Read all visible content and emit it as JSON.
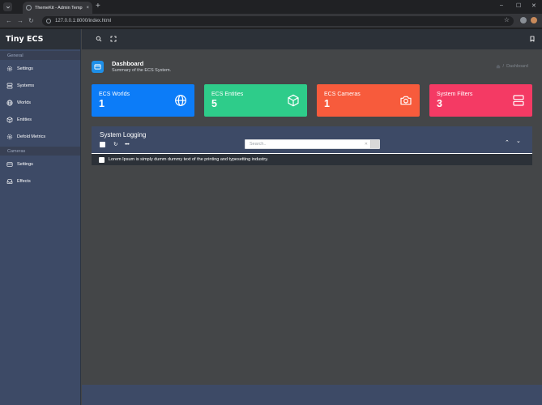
{
  "browser": {
    "tab_title": "ThemeKit - Admin Template",
    "url": "127.0.0.1:8000/index.html",
    "tab_close": "×",
    "new_tab": "+",
    "window_controls": [
      "–",
      "☐",
      "✕"
    ]
  },
  "sidebar": {
    "brand": "Tiny ECS",
    "sections": [
      {
        "title": "General",
        "items": [
          {
            "label": "Settings",
            "icon": "gear-icon"
          },
          {
            "label": "Systems",
            "icon": "server-icon"
          },
          {
            "label": "Worlds",
            "icon": "globe-icon"
          },
          {
            "label": "Entities",
            "icon": "cube-icon"
          },
          {
            "label": "Defold Metrics",
            "icon": "settings-sliders-icon"
          }
        ]
      },
      {
        "title": "Cameras",
        "items": [
          {
            "label": "Settings",
            "icon": "card-icon"
          },
          {
            "label": "Effects",
            "icon": "inbox-icon"
          }
        ]
      }
    ]
  },
  "header": {
    "title": "Dashboard",
    "subtitle": "Summary of the ECS System.",
    "breadcrumb": "Dashboard"
  },
  "cards": [
    {
      "label": "ECS Worlds",
      "value": "1",
      "color": "#0c7cf8",
      "icon": "globe-icon"
    },
    {
      "label": "ECS Entities",
      "value": "5",
      "color": "#2ecc8a",
      "icon": "cube-icon"
    },
    {
      "label": "ECS Cameras",
      "value": "1",
      "color": "#f75b3c",
      "icon": "camera-icon"
    },
    {
      "label": "System Filters",
      "value": "3",
      "color": "#f43a64",
      "icon": "server-icon"
    }
  ],
  "logging": {
    "title": "System Logging",
    "search_placeholder": "Search..",
    "rows": [
      "Lorem Ipsum is simply dumm dummy text of the printing and typesetting industry."
    ]
  },
  "colors": {
    "accent": "#1e8fe8",
    "sidebar": "#3d4a66",
    "topbar": "#2c3138",
    "content_bg": "#444648"
  }
}
